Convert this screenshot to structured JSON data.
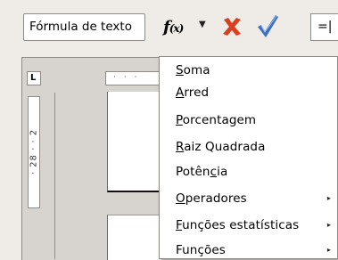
{
  "toolbar": {
    "name_box_value": "Fórmula de texto",
    "function_wizard_icon": "fx-icon",
    "cancel_icon": "x-icon",
    "accept_icon": "check-icon",
    "formula_value": "=|",
    "cancel_color": "#d8401f",
    "accept_color": "#3b6fc4"
  },
  "rulers": {
    "horizontal_text": "· · ·",
    "vertical_text": "· 28 · · 2"
  },
  "menu": {
    "items": [
      {
        "pre": "",
        "u": "S",
        "post": "oma",
        "submenu": false
      },
      {
        "pre": "",
        "u": "A",
        "post": "rred",
        "submenu": false
      },
      {
        "pre": "",
        "u": "P",
        "post": "orcentagem",
        "submenu": false
      },
      {
        "pre": "",
        "u": "R",
        "post": "aiz Quadrada",
        "submenu": false
      },
      {
        "pre": "Potên",
        "u": "c",
        "post": "ia",
        "submenu": false
      },
      {
        "pre": "",
        "u": "O",
        "post": "peradores",
        "submenu": true
      },
      {
        "pre": "",
        "u": "F",
        "post": "unções estatísticas",
        "submenu": true
      },
      {
        "pre": "Funções",
        "u": "",
        "post": "",
        "submenu": true
      }
    ],
    "submenu_arrow": "▸"
  }
}
